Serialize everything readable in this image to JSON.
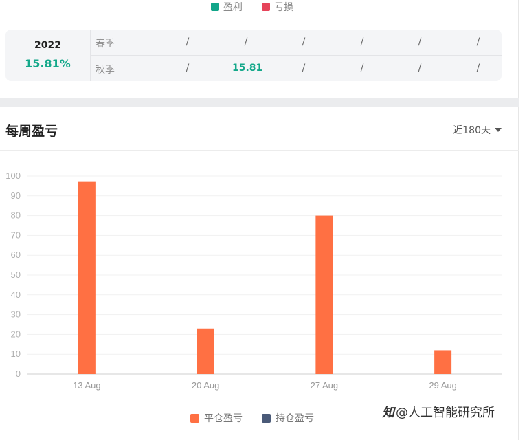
{
  "legend": {
    "profit_label": "盈利",
    "loss_label": "亏损",
    "profit_color": "#12a589",
    "loss_color": "#e6445a"
  },
  "season_card": {
    "year": "2022",
    "year_return": "15.81%",
    "rows": [
      {
        "name": "春季",
        "cells": [
          "/",
          "/",
          "/",
          "/",
          "/",
          "/"
        ]
      },
      {
        "name": "秋季",
        "cells": [
          "/",
          "15.81",
          "/",
          "/",
          "/",
          "/"
        ]
      }
    ]
  },
  "weekly": {
    "title": "每周盈亏",
    "range_label": "近180天"
  },
  "chart_data": {
    "type": "bar",
    "categories": [
      "13 Aug",
      "20 Aug",
      "27 Aug",
      "29 Aug"
    ],
    "series": [
      {
        "name": "平仓盈亏",
        "color": "#ff7043",
        "values": [
          97,
          23,
          80,
          12
        ]
      },
      {
        "name": "持仓盈亏",
        "color": "#4a5a78",
        "values": [
          0,
          0,
          0,
          0
        ]
      }
    ],
    "ylim": [
      0,
      100
    ],
    "yticks": [
      0,
      10,
      20,
      30,
      40,
      50,
      60,
      70,
      80,
      90,
      100
    ],
    "grid": true,
    "legend_position": "bottom-center"
  },
  "watermark": {
    "icon": "知",
    "text": "@人工智能研究所"
  }
}
